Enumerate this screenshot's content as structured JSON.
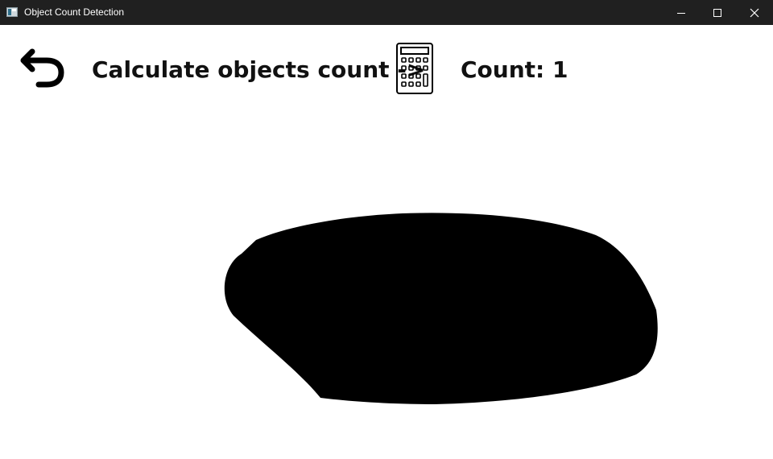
{
  "window": {
    "title": "Object Count Detection",
    "minimize_icon": "minimize-icon",
    "maximize_icon": "maximize-icon",
    "close_icon": "close-icon"
  },
  "toolbar": {
    "back_icon": "undo-arrow-icon",
    "calculate_label": "Calculate objects count ->",
    "calculate_icon": "calculator-icon",
    "count_text": "Count: 1"
  },
  "canvas": {
    "background": "#ffffff",
    "ink_color": "#000000",
    "objects_drawn": 1
  }
}
